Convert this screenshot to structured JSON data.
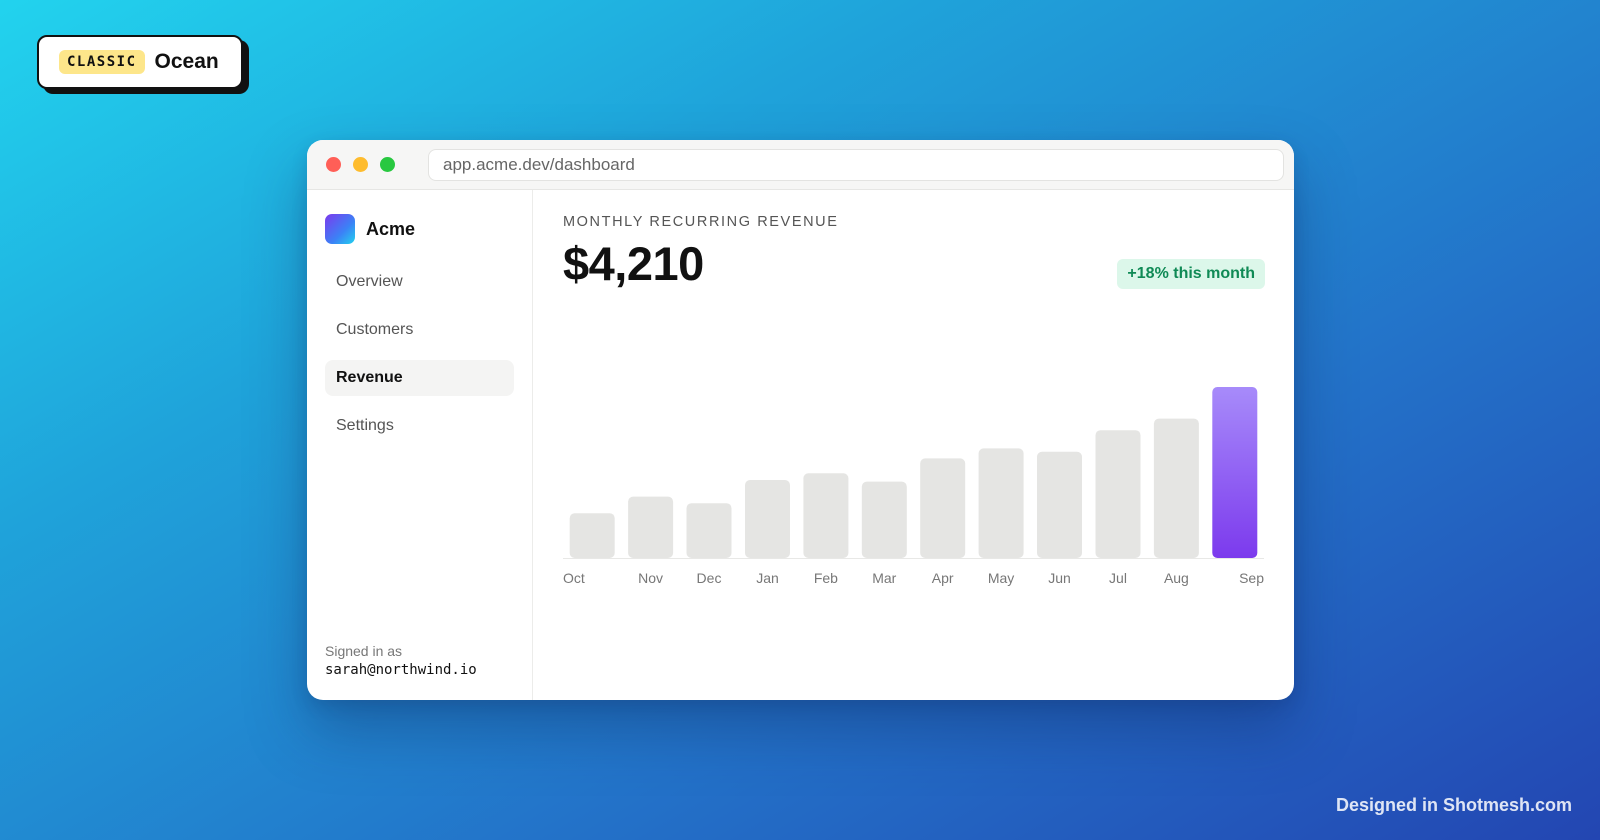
{
  "theme_tag": {
    "badge": "CLASSIC",
    "name": "Ocean"
  },
  "window": {
    "traffic_lights": [
      "close-icon",
      "minimize-icon",
      "zoom-icon"
    ],
    "url": "app.acme.dev/dashboard"
  },
  "sidebar": {
    "brand": "Acme",
    "items": [
      {
        "label": "Overview",
        "active": false
      },
      {
        "label": "Customers",
        "active": false
      },
      {
        "label": "Revenue",
        "active": true
      },
      {
        "label": "Settings",
        "active": false
      }
    ],
    "signed_in_label": "Signed in as",
    "signed_in_email": "sarah@northwind.io"
  },
  "main": {
    "kpi_label": "MONTHLY RECURRING REVENUE",
    "kpi_value": "$4,210",
    "delta": "+18% this month"
  },
  "chart_data": {
    "type": "bar",
    "categories": [
      "Oct",
      "Nov",
      "Dec",
      "Jan",
      "Feb",
      "Mar",
      "Apr",
      "May",
      "Jun",
      "Jul",
      "Aug",
      "Sep"
    ],
    "values": [
      27,
      37,
      33,
      47,
      51,
      46,
      60,
      66,
      64,
      77,
      84,
      103
    ],
    "highlight_index": 11,
    "colors": {
      "bar": "#e5e5e3",
      "highlight_top": "#a78bfa",
      "highlight_bottom": "#7c3aed",
      "axis_label": "#777777"
    }
  },
  "footer": {
    "credit": "Designed in Shotmesh.com"
  }
}
